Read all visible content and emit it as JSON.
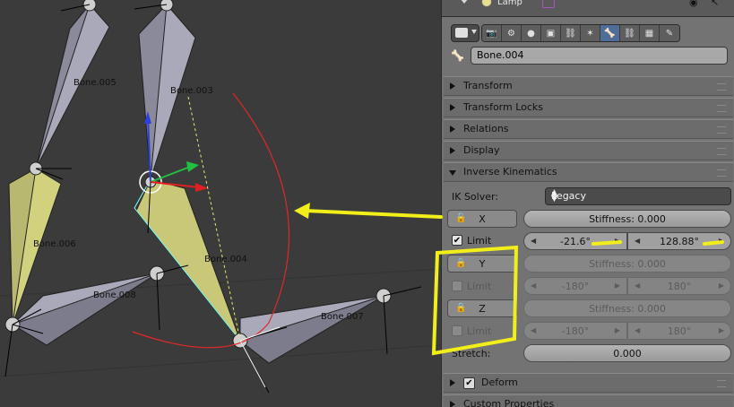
{
  "viewport": {
    "bones": [
      {
        "name": "Bone.005"
      },
      {
        "name": "Bone.003"
      },
      {
        "name": "Bone.006"
      },
      {
        "name": "Bone.004"
      },
      {
        "name": "Bone.008"
      },
      {
        "name": "Bone.007"
      }
    ]
  },
  "outliner": {
    "item_label": "Lamp"
  },
  "tabs": [
    {
      "icon": "render-icon"
    },
    {
      "icon": "scene-icon"
    },
    {
      "icon": "world-icon"
    },
    {
      "icon": "object-icon"
    },
    {
      "icon": "constraints-icon"
    },
    {
      "icon": "armature-data-icon"
    },
    {
      "icon": "bone-icon",
      "active": true
    },
    {
      "icon": "bone-constraints-icon"
    },
    {
      "icon": "material-icon"
    },
    {
      "icon": "texture-icon"
    }
  ],
  "bone_name": "Bone.004",
  "sections": {
    "transform": "Transform",
    "transform_locks": "Transform Locks",
    "relations": "Relations",
    "display": "Display",
    "inverse_kinematics": "Inverse Kinematics",
    "deform": "Deform",
    "custom_properties": "Custom Properties"
  },
  "ik": {
    "solver_label": "IK Solver:",
    "solver_value": "Legacy",
    "limit_label": "Limit",
    "stretch_label": "Stretch:",
    "stretch_value": "0.000",
    "axes": [
      {
        "axis": "X",
        "stiffness": "Stiffness: 0.000",
        "limit_checked": true,
        "min": "-21.6°",
        "max": "128.88°"
      },
      {
        "axis": "Y",
        "stiffness": "Stiffness: 0.000",
        "limit_checked": false,
        "min": "-180°",
        "max": "180°"
      },
      {
        "axis": "Z",
        "stiffness": "Stiffness: 0.000",
        "limit_checked": false,
        "min": "-180°",
        "max": "180°"
      }
    ]
  },
  "colors": {
    "annotation": "#f2ee1a",
    "active_tab": "#4f6d9a",
    "bone_selected": "#cfcf7a",
    "bone_default": "#a8a8b8"
  }
}
